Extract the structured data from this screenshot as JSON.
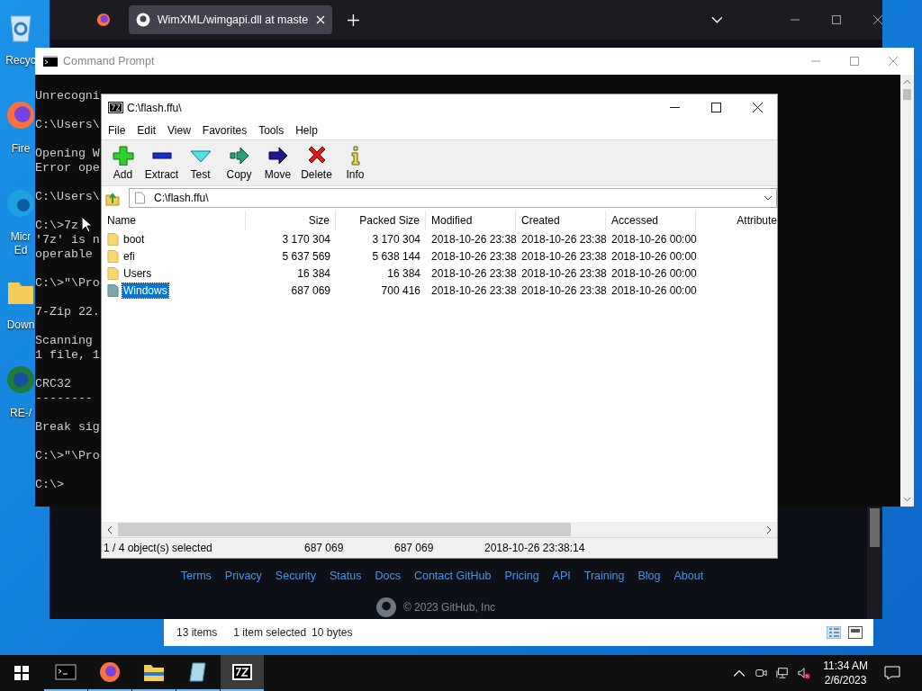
{
  "desktop_icons": [
    {
      "kind": "recycle",
      "label": "Recyc"
    },
    {
      "kind": "firefox",
      "label": "Fire"
    },
    {
      "kind": "edge",
      "label": "Micr Ed"
    },
    {
      "kind": "folder",
      "label": "Down"
    },
    {
      "kind": "app",
      "label": "RE-/"
    }
  ],
  "browser": {
    "tab_title": "WimXML/wimgapi.dll at maste",
    "footer_links": [
      "Terms",
      "Privacy",
      "Security",
      "Status",
      "Docs",
      "Contact GitHub",
      "Pricing",
      "API",
      "Training",
      "Blog",
      "About"
    ],
    "copyright": "© 2023 GitHub, Inc"
  },
  "explorer": {
    "status": [
      "13 items",
      "1 item selected",
      "10 bytes"
    ]
  },
  "cmd": {
    "title": "Command Prompt",
    "blocks": [
      [
        "Unrecogni"
      ],
      [
        "C:\\Users\\"
      ],
      [
        "Opening W",
        "Error ope"
      ],
      [
        "C:\\Users\\"
      ],
      [
        "C:\\>7z",
        "'7z' is n",
        "operable"
      ],
      [
        "C:\\>\"\\Pro"
      ],
      [
        "7-Zip 22."
      ],
      [
        "Scanning",
        "1 file, 1"
      ],
      [
        "CRC32",
        "--------"
      ],
      [
        "Break sig"
      ],
      [
        "C:\\>\"\\Pro"
      ],
      [
        "C:\\>"
      ]
    ]
  },
  "sevenzip": {
    "title": "C:\\flash.ffu\\",
    "menu": [
      "File",
      "Edit",
      "View",
      "Favorites",
      "Tools",
      "Help"
    ],
    "toolbar": [
      {
        "kind": "add",
        "label": "Add"
      },
      {
        "kind": "extract",
        "label": "Extract"
      },
      {
        "kind": "test",
        "label": "Test"
      },
      {
        "kind": "copy",
        "label": "Copy"
      },
      {
        "kind": "move",
        "label": "Move"
      },
      {
        "kind": "delete",
        "label": "Delete"
      },
      {
        "kind": "info",
        "label": "Info"
      }
    ],
    "path": "C:\\flash.ffu\\",
    "columns": [
      "Name",
      "Size",
      "Packed Size",
      "Modified",
      "Created",
      "Accessed",
      "Attribute"
    ],
    "rows": [
      {
        "name": "boot",
        "size": "3 170 304",
        "packed": "3 170 304",
        "modified": "2018-10-26 23:38",
        "created": "2018-10-26 23:38",
        "accessed": "2018-10-26 00:00",
        "selected": false
      },
      {
        "name": "efi",
        "size": "5 637 569",
        "packed": "5 638 144",
        "modified": "2018-10-26 23:38",
        "created": "2018-10-26 23:38",
        "accessed": "2018-10-26 00:00",
        "selected": false
      },
      {
        "name": "Users",
        "size": "16 384",
        "packed": "16 384",
        "modified": "2018-10-26 23:38",
        "created": "2018-10-26 23:38",
        "accessed": "2018-10-26 00:00",
        "selected": false
      },
      {
        "name": "Windows",
        "size": "687 069",
        "packed": "700 416",
        "modified": "2018-10-26 23:38",
        "created": "2018-10-26 23:38",
        "accessed": "2018-10-26 00:00",
        "selected": true
      }
    ],
    "status": [
      "1 / 4 object(s) selected",
      "687 069",
      "687 069",
      "2018-10-26 23:38:14"
    ]
  },
  "taskbar": {
    "apps": [
      {
        "kind": "cmd",
        "selected": false
      },
      {
        "kind": "firefox",
        "selected": false
      },
      {
        "kind": "explorer",
        "selected": false
      },
      {
        "kind": "notepad",
        "selected": false
      },
      {
        "kind": "sevenzip",
        "selected": true
      }
    ],
    "time": "11:34 AM",
    "date": "2/6/2023"
  }
}
